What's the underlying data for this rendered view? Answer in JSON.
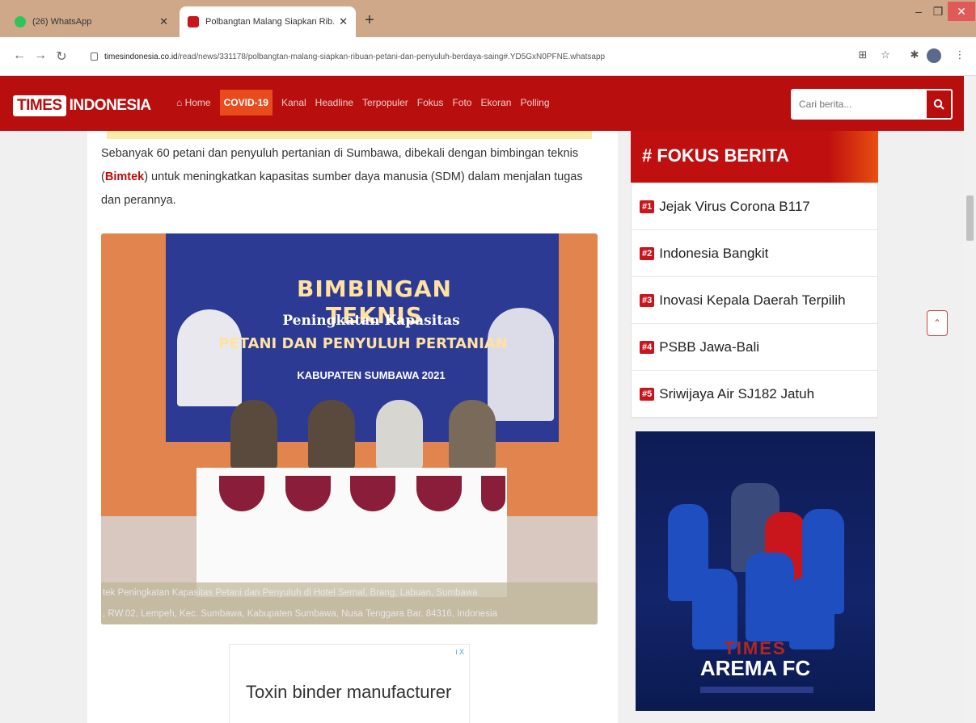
{
  "browser": {
    "tabs": [
      {
        "title": "(26) WhatsApp",
        "active": false
      },
      {
        "title": "Polbangtan Malang Siapkan Rib...",
        "active": true
      }
    ],
    "url_host": "timesindonesia.co.id",
    "url_path": "/read/news/331178/polbangtan-malang-siapkan-ribuan-petani-dan-penyuluh-berdaya-saing#.YD5GxN0PFNE.whatsapp",
    "colors": {
      "tabstrip": "#cfa88a",
      "close": "#e05a5a"
    }
  },
  "site": {
    "logo_times": "TIMES",
    "logo_indonesia": "INDONESIA",
    "nav": [
      "Home",
      "COVID-19",
      "Kanal",
      "Headline",
      "Terpopuler",
      "Fokus",
      "Foto",
      "Ekoran",
      "Polling"
    ],
    "search_placeholder": "Cari berita...",
    "brand_color": "#b90e0e",
    "covid_color": "#e84c1e"
  },
  "article": {
    "lead_part1": "Sebanyak 60 petani dan penyuluh pertanian di Sumbawa, dibekali dengan bimbingan teknis (",
    "lead_highlight": "Bimtek",
    "lead_part2": ") untuk meningkatkan kapasitas sumber daya manusia (SDM) dalam menjalan tugas dan perannya.",
    "photo": {
      "banner_title": "BIMBINGAN TEKNIS",
      "banner_sub": "Peningkatan Kapasitas",
      "banner_sub2": "PETANI DAN PENYULUH PERTANIAN",
      "banner_sub3": "KABUPATEN SUMBAWA 2021",
      "caption_line1": "tek Peningkatan Kapasitas Petani dan Penyuluh di Hotel Sernal, Brang, Labuan, Sumbawa",
      "caption_line2": ", RW.02, Lempeh, Kec. Sumbawa, Kabupaten Sumbawa, Nusa Tenggara Bar. 84316, Indonesia"
    },
    "ad": {
      "text": "Toxin binder manufacturer",
      "badge": "i X"
    }
  },
  "sidebar": {
    "fokus_title": "# FOKUS BERITA",
    "fokus_items": [
      {
        "num": "#1",
        "label": "Jejak Virus Corona B117"
      },
      {
        "num": "#2",
        "label": "Indonesia Bangkit"
      },
      {
        "num": "#3",
        "label": "Inovasi Kepala Daerah Terpilih"
      },
      {
        "num": "#4",
        "label": "PSBB Jawa-Bali"
      },
      {
        "num": "#5",
        "label": "Sriwijaya Air SJ182 Jatuh"
      }
    ],
    "arema": {
      "times": "TIMES",
      "title": "AREMA FC"
    }
  }
}
